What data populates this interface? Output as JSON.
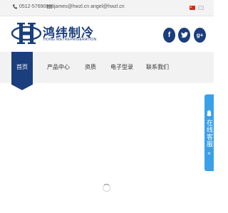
{
  "topbar": {
    "phone": "0512-57690688",
    "email": "james@hwzl.cn angel@hwzl.cn",
    "languages": [
      "cn-flag",
      "en-flag"
    ]
  },
  "brand": {
    "name_cn": "鸿纬制冷",
    "name_en": "HONG WEI REFRIGERATION",
    "color": "#1b3e7d"
  },
  "social": {
    "facebook": "f",
    "twitter": "t",
    "googleplus": "g+"
  },
  "nav": {
    "items": [
      {
        "label": "首页"
      },
      {
        "label": "产品中心"
      },
      {
        "label": "资质"
      },
      {
        "label": "电子型录"
      },
      {
        "label": "联系我们"
      }
    ]
  },
  "service": {
    "label": "在线客服",
    "arrow": "«",
    "color": "#3aa0e8"
  }
}
